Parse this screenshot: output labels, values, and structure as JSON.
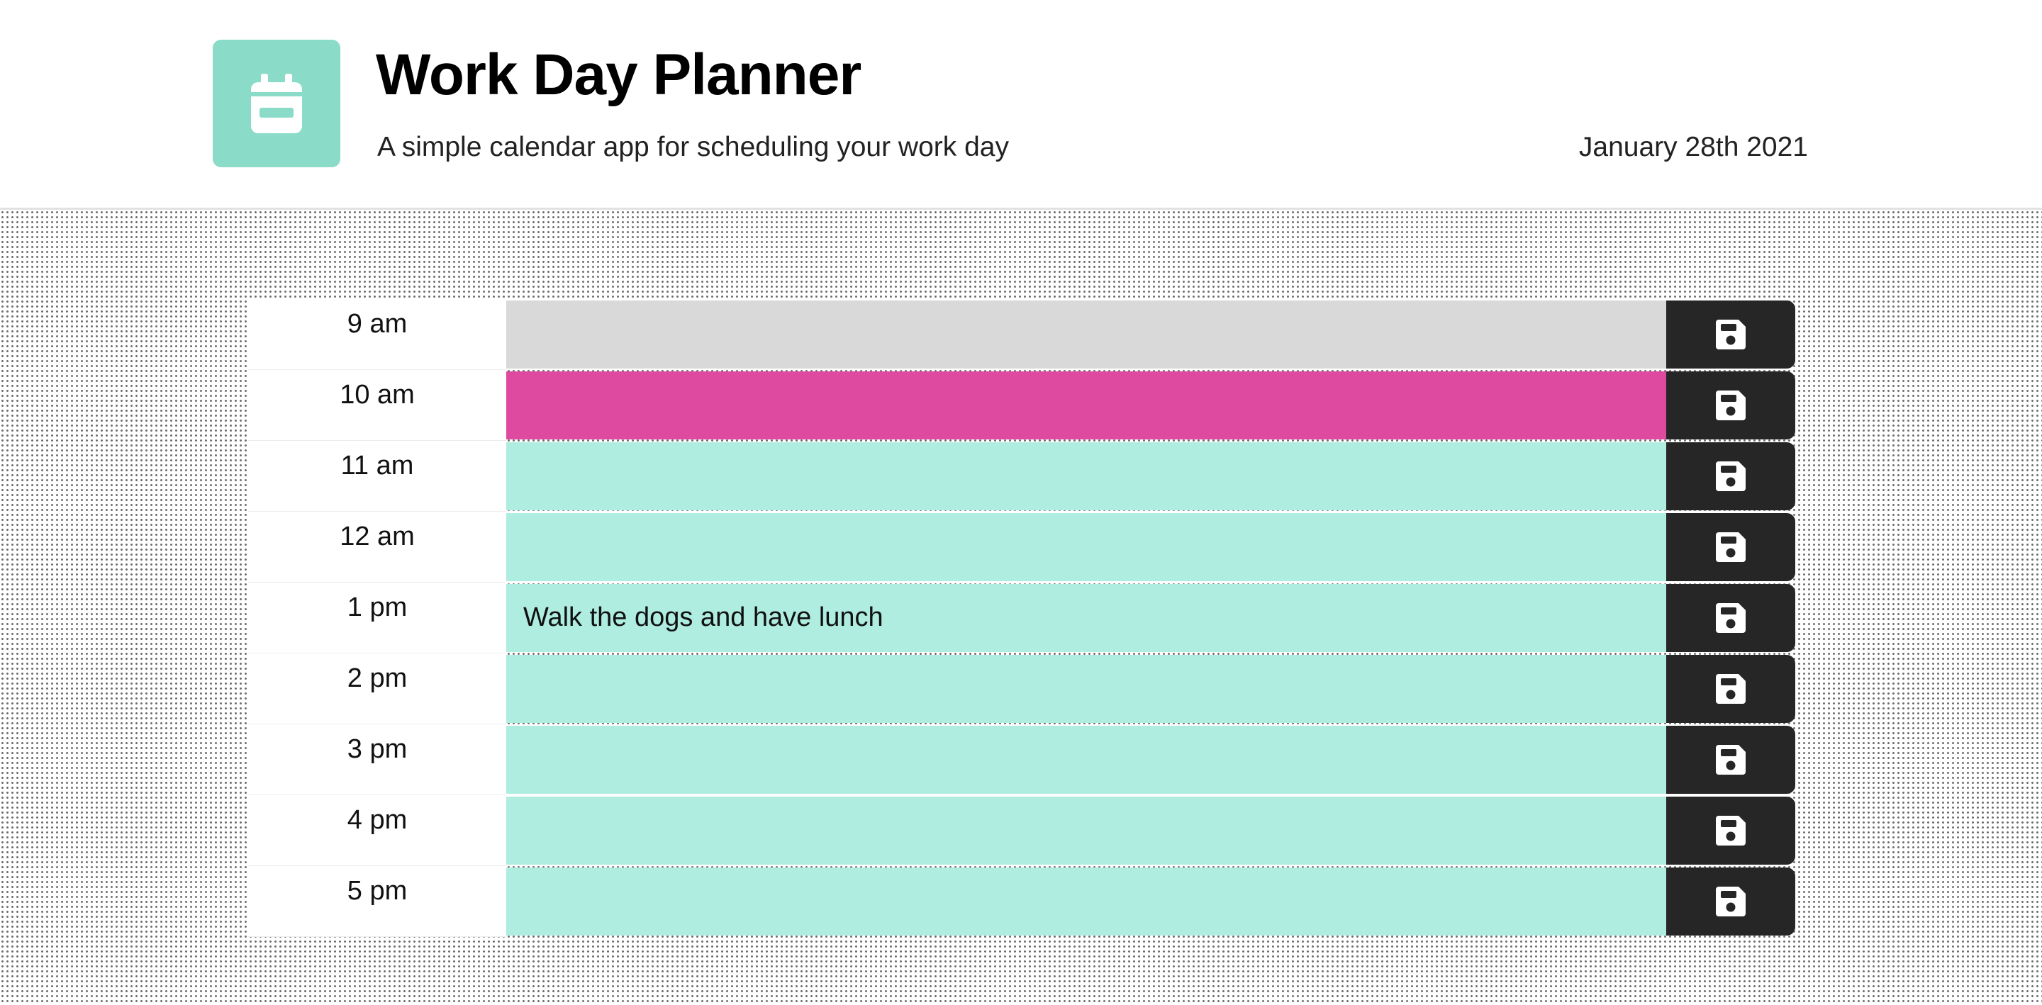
{
  "header": {
    "title": "Work Day Planner",
    "subtitle": "A simple calendar app for scheduling your work day",
    "date": "January 28th 2021",
    "icon": "calendar-icon",
    "icon_bg": "#8adbc8"
  },
  "colors": {
    "past": "#d9d9d9",
    "present": "#dd4aa0",
    "future": "#afede0",
    "save_button": "#262626"
  },
  "rows": [
    {
      "hour": "9 am",
      "state": "past",
      "task": ""
    },
    {
      "hour": "10 am",
      "state": "present",
      "task": ""
    },
    {
      "hour": "11 am",
      "state": "future",
      "task": ""
    },
    {
      "hour": "12 am",
      "state": "future",
      "task": ""
    },
    {
      "hour": "1 pm",
      "state": "future",
      "task": "Walk the dogs and have lunch"
    },
    {
      "hour": "2 pm",
      "state": "future",
      "task": ""
    },
    {
      "hour": "3 pm",
      "state": "future",
      "task": ""
    },
    {
      "hour": "4 pm",
      "state": "future",
      "task": ""
    },
    {
      "hour": "5 pm",
      "state": "future",
      "task": ""
    }
  ],
  "save_icon": "floppy-disk-icon"
}
